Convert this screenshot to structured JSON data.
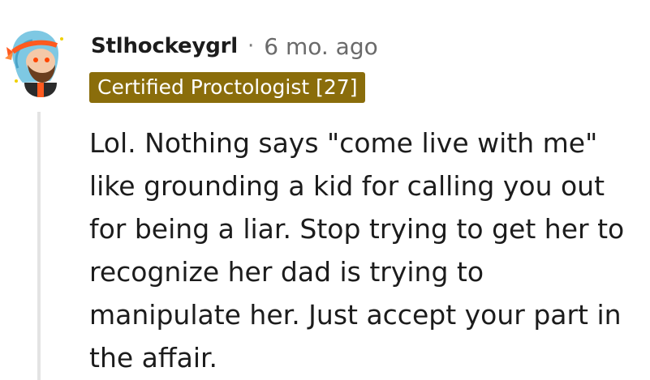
{
  "comment": {
    "username": "Stlhockeygrl",
    "separator": "·",
    "timestamp": "6 mo. ago",
    "flair": "Certified Proctologist [27]",
    "flair_color": "#8a6d0b",
    "avatar_icon": "snoo-avatar-icon",
    "body": "Lol. Nothing says \"come live with me\" like grounding a kid for calling you out for being a liar. Stop trying to get her to recognize her dad is trying to manipulate her. Just accept your part in the affair."
  }
}
